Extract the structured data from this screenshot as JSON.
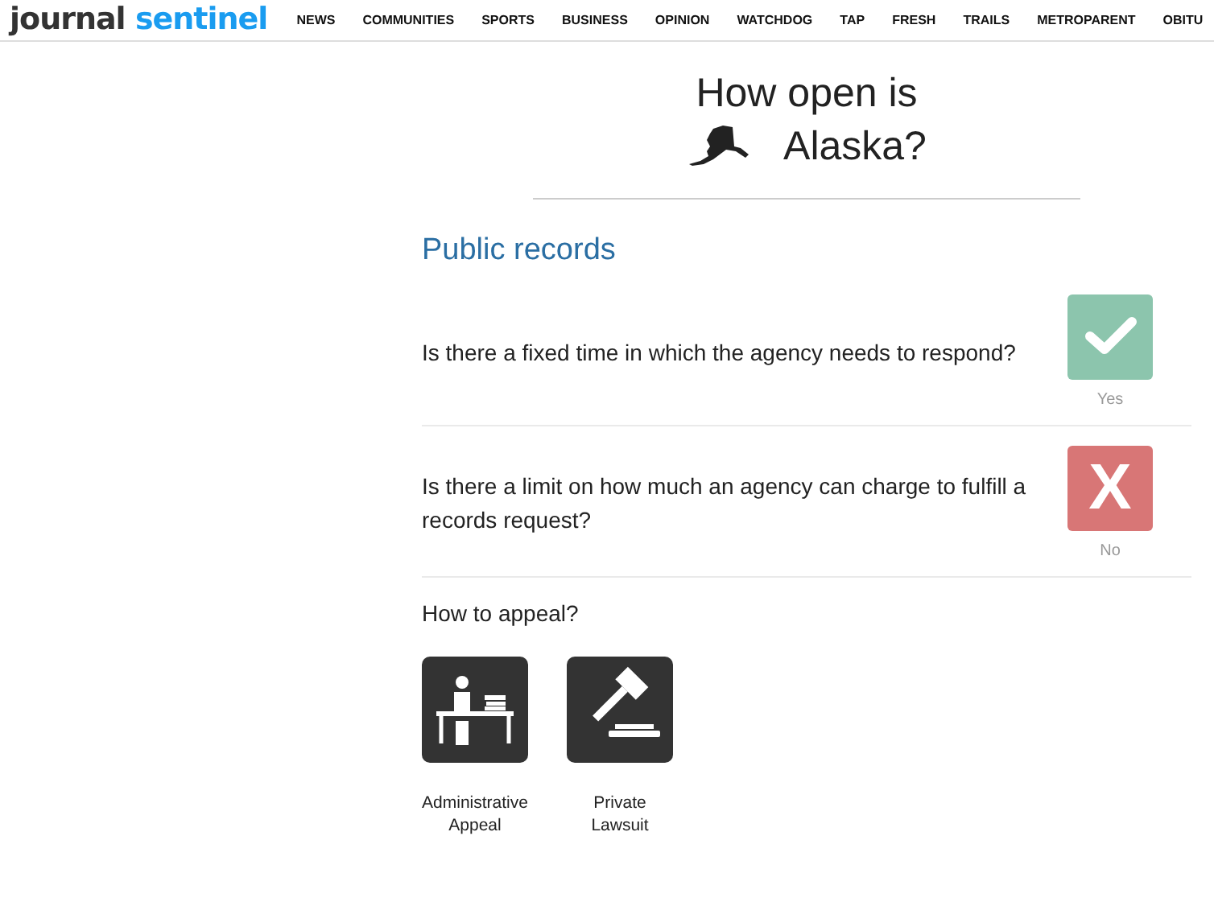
{
  "header": {
    "logo": {
      "first": "journal",
      "second": "sentinel"
    },
    "nav": [
      "NEWS",
      "COMMUNITIES",
      "SPORTS",
      "BUSINESS",
      "OPINION",
      "WATCHDOG",
      "TAP",
      "FRESH",
      "TRAILS",
      "METROPARENT",
      "OBITU"
    ]
  },
  "title": {
    "line_1": "How open is",
    "state": "Alaska?"
  },
  "section": {
    "heading": "Public records",
    "questions": [
      {
        "text": "Is there a fixed time in which the agency needs to respond?",
        "kind": "yes",
        "answer_label": "Yes"
      },
      {
        "text": "Is there a limit on how much an agency can charge to fulfill a records request?",
        "kind": "no",
        "mark": "X",
        "answer_label": "No"
      }
    ],
    "appeal": {
      "heading": "How to appeal?",
      "options": [
        {
          "kind": "administrative",
          "line_1": "Administrative",
          "line_2": "Appeal"
        },
        {
          "kind": "lawsuit",
          "line_1": "Private",
          "line_2": "Lawsuit"
        }
      ]
    }
  }
}
